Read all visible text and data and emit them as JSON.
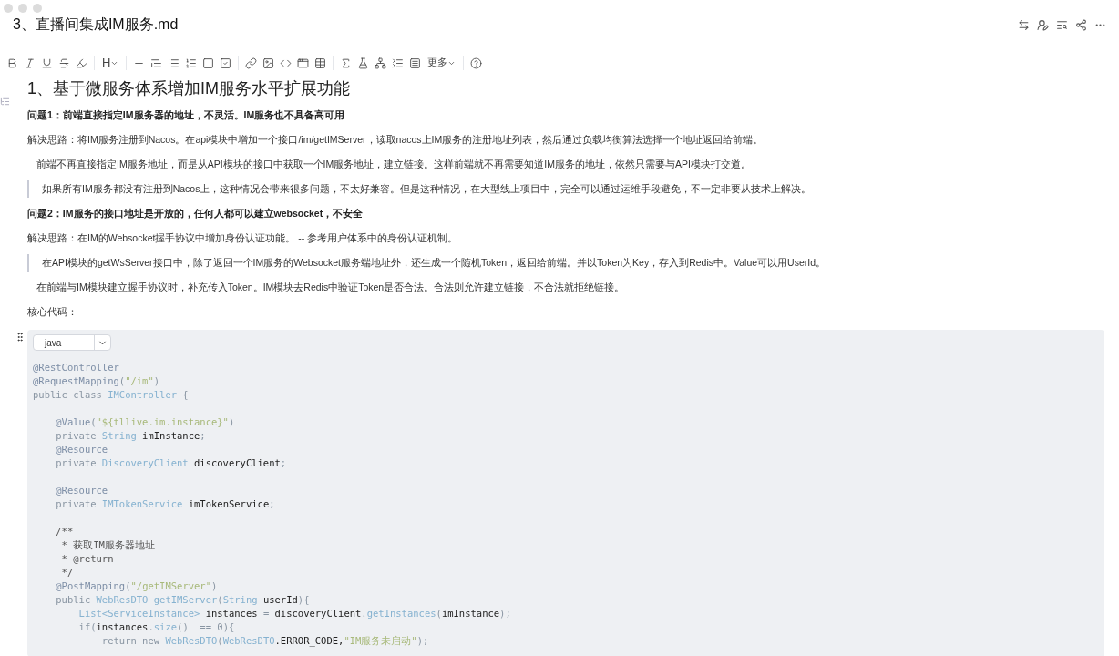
{
  "window": {
    "title": "3、直播间集成IM服务.md"
  },
  "toolbar": {
    "heading_label": "H",
    "more_label": "更多"
  },
  "blocks": [
    {
      "kind": "h1",
      "text": "1、基于微服务体系增加IM服务水平扩展功能"
    },
    {
      "kind": "strong",
      "text": "问题1：前端直接指定IM服务器的地址，不灵活。IM服务也不具备高可用"
    },
    {
      "kind": "p",
      "text": "解决思路：将IM服务注册到Nacos。在api模块中增加一个接口/im/getIMServer，读取nacos上IM服务的注册地址列表，然后通过负载均衡算法选择一个地址返回给前端。"
    },
    {
      "kind": "indent",
      "text": "前端不再直接指定IM服务地址，而是从API模块的接口中获取一个IM服务地址，建立链接。这样前端就不再需要知道IM服务的地址，依然只需要与API模块打交道。"
    },
    {
      "kind": "quote",
      "text": "如果所有IM服务都没有注册到Nacos上，这种情况会带来很多问题，不太好兼容。但是这种情况，在大型线上项目中，完全可以通过运维手段避免，不一定非要从技术上解决。"
    },
    {
      "kind": "strong",
      "text": "问题2：IM服务的接口地址是开放的，任何人都可以建立websocket，不安全"
    },
    {
      "kind": "p",
      "text": "解决思路：在IM的Websocket握手协议中增加身份认证功能。 -- 参考用户体系中的身份认证机制。"
    },
    {
      "kind": "quote",
      "text": "在API模块的getWsServer接口中，除了返回一个IM服务的Websocket服务端地址外，还生成一个随机Token，返回给前端。并以Token为Key，存入到Redis中。Value可以用UserId。"
    },
    {
      "kind": "indent",
      "text": "在前端与IM模块建立握手协议时，补充传入Token。IM模块去Redis中验证Token是否合法。合法则允许建立链接，不合法就拒绝链接。"
    },
    {
      "kind": "p",
      "text": "核心代码："
    }
  ],
  "code": {
    "language": "java",
    "lines": [
      {
        "kind": "code",
        "tokens": [
          {
            "text": "@RestController",
            "kind": "ann"
          }
        ]
      },
      {
        "kind": "code",
        "tokens": [
          {
            "text": "@RequestMapping",
            "kind": "ann"
          },
          {
            "text": "(",
            "kind": "punct"
          },
          {
            "text": "\"/im\"",
            "kind": "str"
          },
          {
            "text": ")",
            "kind": "punct"
          }
        ]
      },
      {
        "kind": "code",
        "tokens": [
          {
            "text": "public class ",
            "kind": "kw"
          },
          {
            "text": "IMController",
            "kind": "type"
          },
          {
            "text": " {",
            "kind": "punct"
          }
        ]
      },
      {
        "kind": "blank"
      },
      {
        "kind": "code",
        "tokens": [
          {
            "text": "    @Value",
            "kind": "ann"
          },
          {
            "text": "(",
            "kind": "punct"
          },
          {
            "text": "\"${tllive.im.instance}\"",
            "kind": "str"
          },
          {
            "text": ")",
            "kind": "punct"
          }
        ]
      },
      {
        "kind": "code",
        "tokens": [
          {
            "text": "    private ",
            "kind": "kw"
          },
          {
            "text": "String",
            "kind": "type"
          },
          {
            "text": " imInstance",
            "kind": "plain"
          },
          {
            "text": ";",
            "kind": "punct"
          }
        ]
      },
      {
        "kind": "code",
        "tokens": [
          {
            "text": "    @Resource",
            "kind": "ann"
          }
        ]
      },
      {
        "kind": "code",
        "tokens": [
          {
            "text": "    private ",
            "kind": "kw"
          },
          {
            "text": "DiscoveryClient",
            "kind": "type"
          },
          {
            "text": " discoveryClient",
            "kind": "plain"
          },
          {
            "text": ";",
            "kind": "punct"
          }
        ]
      },
      {
        "kind": "blank"
      },
      {
        "kind": "code",
        "tokens": [
          {
            "text": "    @Resource",
            "kind": "ann"
          }
        ]
      },
      {
        "kind": "code",
        "tokens": [
          {
            "text": "    private ",
            "kind": "kw"
          },
          {
            "text": "IMTokenService",
            "kind": "type"
          },
          {
            "text": " imTokenService",
            "kind": "plain"
          },
          {
            "text": ";",
            "kind": "punct"
          }
        ]
      },
      {
        "kind": "blank"
      },
      {
        "kind": "code",
        "tokens": [
          {
            "text": "    /**",
            "kind": "comment"
          }
        ]
      },
      {
        "kind": "code",
        "tokens": [
          {
            "text": "     * 获取IM服务器地址",
            "kind": "comment"
          }
        ]
      },
      {
        "kind": "code",
        "tokens": [
          {
            "text": "     * @return",
            "kind": "comment"
          }
        ]
      },
      {
        "kind": "code",
        "tokens": [
          {
            "text": "     */",
            "kind": "comment"
          }
        ]
      },
      {
        "kind": "code",
        "tokens": [
          {
            "text": "    @PostMapping",
            "kind": "ann"
          },
          {
            "text": "(",
            "kind": "punct"
          },
          {
            "text": "\"/getIMServer\"",
            "kind": "str"
          },
          {
            "text": ")",
            "kind": "punct"
          }
        ]
      },
      {
        "kind": "code",
        "tokens": [
          {
            "text": "    public ",
            "kind": "kw"
          },
          {
            "text": "WebResDTO getIMServer",
            "kind": "type"
          },
          {
            "text": "(",
            "kind": "punct"
          },
          {
            "text": "String",
            "kind": "type"
          },
          {
            "text": " userId",
            "kind": "plain"
          },
          {
            "text": "){",
            "kind": "punct"
          }
        ]
      },
      {
        "kind": "code",
        "tokens": [
          {
            "text": "        List<ServiceInstance>",
            "kind": "type"
          },
          {
            "text": " instances ",
            "kind": "plain"
          },
          {
            "text": "=",
            "kind": "punct"
          },
          {
            "text": " discoveryClient",
            "kind": "plain"
          },
          {
            "text": ".",
            "kind": "punct"
          },
          {
            "text": "getInstances",
            "kind": "type"
          },
          {
            "text": "(",
            "kind": "punct"
          },
          {
            "text": "imInstance",
            "kind": "plain"
          },
          {
            "text": ");",
            "kind": "punct"
          }
        ]
      },
      {
        "kind": "code",
        "tokens": [
          {
            "text": "        if",
            "kind": "kw"
          },
          {
            "text": "(",
            "kind": "punct"
          },
          {
            "text": "instances",
            "kind": "plain"
          },
          {
            "text": ".",
            "kind": "punct"
          },
          {
            "text": "size",
            "kind": "type"
          },
          {
            "text": "()  ==",
            "kind": "punct"
          },
          {
            "text": " 0",
            "kind": "kw"
          },
          {
            "text": "){",
            "kind": "punct"
          }
        ]
      },
      {
        "kind": "code",
        "tokens": [
          {
            "text": "            return new ",
            "kind": "kw"
          },
          {
            "text": "WebResDTO",
            "kind": "type"
          },
          {
            "text": "(",
            "kind": "punct"
          },
          {
            "text": "WebResDTO",
            "kind": "type"
          },
          {
            "text": ".ERROR_CODE,",
            "kind": "plain"
          },
          {
            "text": "\"IM服务未启动\"",
            "kind": "str"
          },
          {
            "text": ");",
            "kind": "punct"
          }
        ]
      }
    ]
  }
}
